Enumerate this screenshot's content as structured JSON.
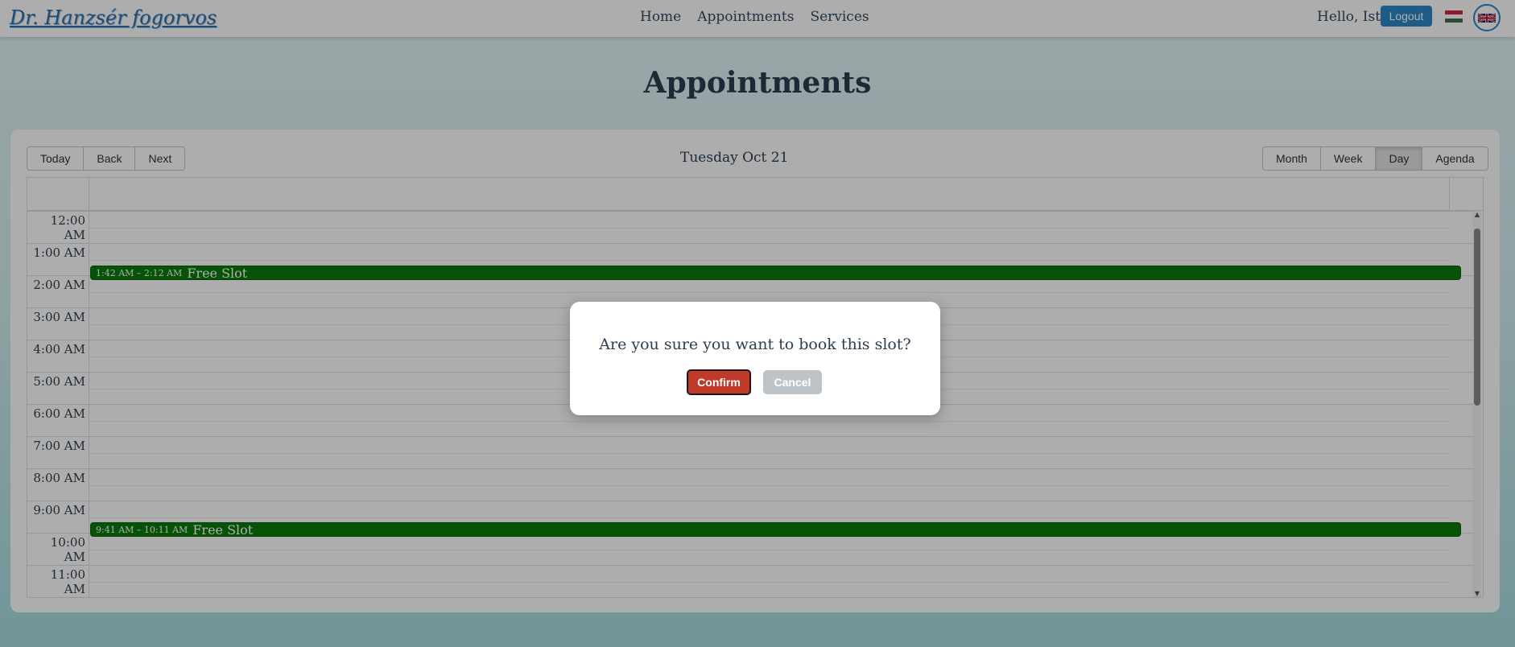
{
  "nav": {
    "brand": "Dr. Hanzsér fogorvos",
    "links": [
      "Home",
      "Appointments",
      "Services"
    ],
    "greeting": "Hello, Isti",
    "logout_label": "Logout"
  },
  "page_title": "Appointments",
  "calendar": {
    "nav_buttons": [
      "Today",
      "Back",
      "Next"
    ],
    "date_label": "Tuesday Oct 21",
    "views": [
      "Month",
      "Week",
      "Day",
      "Agenda"
    ],
    "active_view": "Day",
    "time_slots": [
      "12:00 AM",
      "1:00 AM",
      "2:00 AM",
      "3:00 AM",
      "4:00 AM",
      "5:00 AM",
      "6:00 AM",
      "7:00 AM",
      "8:00 AM",
      "9:00 AM",
      "10:00 AM",
      "11:00 AM"
    ],
    "events": [
      {
        "time": "1:42 AM – 2:12 AM",
        "title": "Free Slot",
        "start_hour": 1.7,
        "color": "#0a7a0a"
      },
      {
        "time": "9:41 AM – 10:11 AM",
        "title": "Free Slot",
        "start_hour": 9.68,
        "color": "#0a7a0a"
      }
    ]
  },
  "modal": {
    "question": "Are you sure you want to book this slot?",
    "confirm_label": "Confirm",
    "cancel_label": "Cancel"
  },
  "colors": {
    "accent": "#2f86c8",
    "confirm": "#c0392b",
    "cancel": "#bdc3c7",
    "event": "#0a7a0a"
  }
}
